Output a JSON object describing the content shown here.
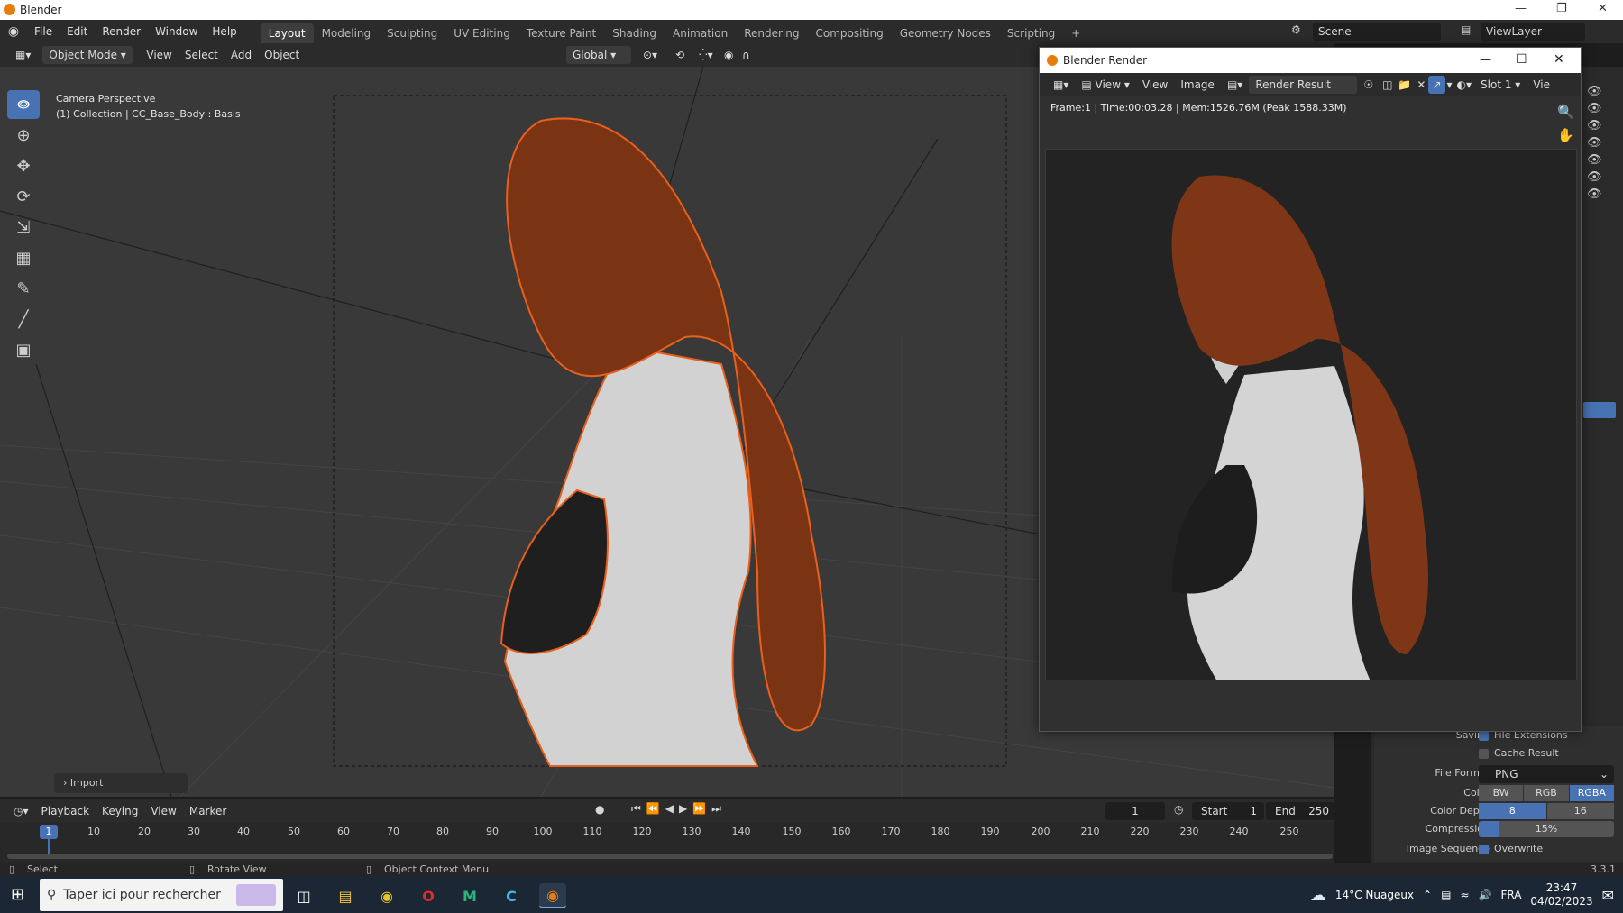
{
  "os": {
    "window_title": "Blender"
  },
  "topbar": {
    "menus": [
      "File",
      "Edit",
      "Render",
      "Window",
      "Help"
    ],
    "workspaces": [
      "Layout",
      "Modeling",
      "Sculpting",
      "UV Editing",
      "Texture Paint",
      "Shading",
      "Animation",
      "Rendering",
      "Compositing",
      "Geometry Nodes",
      "Scripting"
    ],
    "active_workspace": "Layout",
    "add_tab": "+",
    "scene": "Scene",
    "view_layer": "ViewLayer"
  },
  "viewport_header": {
    "mode": "Object Mode",
    "menus": [
      "View",
      "Select",
      "Add",
      "Object"
    ],
    "orientation": "Global"
  },
  "viewport": {
    "camera_label": "Camera Perspective",
    "collection_label": "(1) Collection | CC_Base_Body : Basis",
    "last_operator": "Import"
  },
  "timeline": {
    "menus": [
      "Playback",
      "Keying",
      "View",
      "Marker"
    ],
    "current_frame": "1",
    "start_label": "Start",
    "start": "1",
    "end_label": "End",
    "end": "250",
    "ticks": [
      "1",
      "10",
      "20",
      "30",
      "40",
      "50",
      "60",
      "70",
      "80",
      "90",
      "100",
      "110",
      "120",
      "130",
      "140",
      "150",
      "160",
      "170",
      "180",
      "190",
      "200",
      "210",
      "220",
      "230",
      "240",
      "250"
    ]
  },
  "statusbar": {
    "select": "Select",
    "rotate": "Rotate View",
    "context": "Object Context Menu",
    "version": "3.3.1"
  },
  "render_window": {
    "title": "Blender Render",
    "menus": [
      "View",
      "View",
      "Image"
    ],
    "image_name": "Render Result",
    "slot": "Slot 1",
    "view_short": "Vie",
    "frame_info": "Frame:1 | Time:00:03.28 | Mem:1526.76M (Peak 1588.33M)"
  },
  "properties": {
    "saving_label": "Saving",
    "file_extensions": "File Extensions",
    "cache_result": "Cache Result",
    "file_format_label": "File Format",
    "file_format": "PNG",
    "color_label": "Color",
    "color_options": [
      "BW",
      "RGB",
      "RGBA"
    ],
    "color_selected": "RGBA",
    "color_depth_label": "Color Depth",
    "color_depth_options": [
      "8",
      "16"
    ],
    "color_depth_selected": "8",
    "compression_label": "Compression",
    "compression": "15%",
    "compression_fraction": 0.15,
    "image_sequence_label": "Image Sequence",
    "overwrite": "Overwrite"
  },
  "taskbar": {
    "search_placeholder": "Taper ici pour rechercher",
    "weather": "14°C Nuageux",
    "language": "FRA",
    "time": "23:47",
    "date": "04/02/2023"
  },
  "colors": {
    "accent": "#4772b3",
    "selection_outline": "#e8601c",
    "hair": "#8a3a14",
    "skin": "#d9d9d9"
  }
}
